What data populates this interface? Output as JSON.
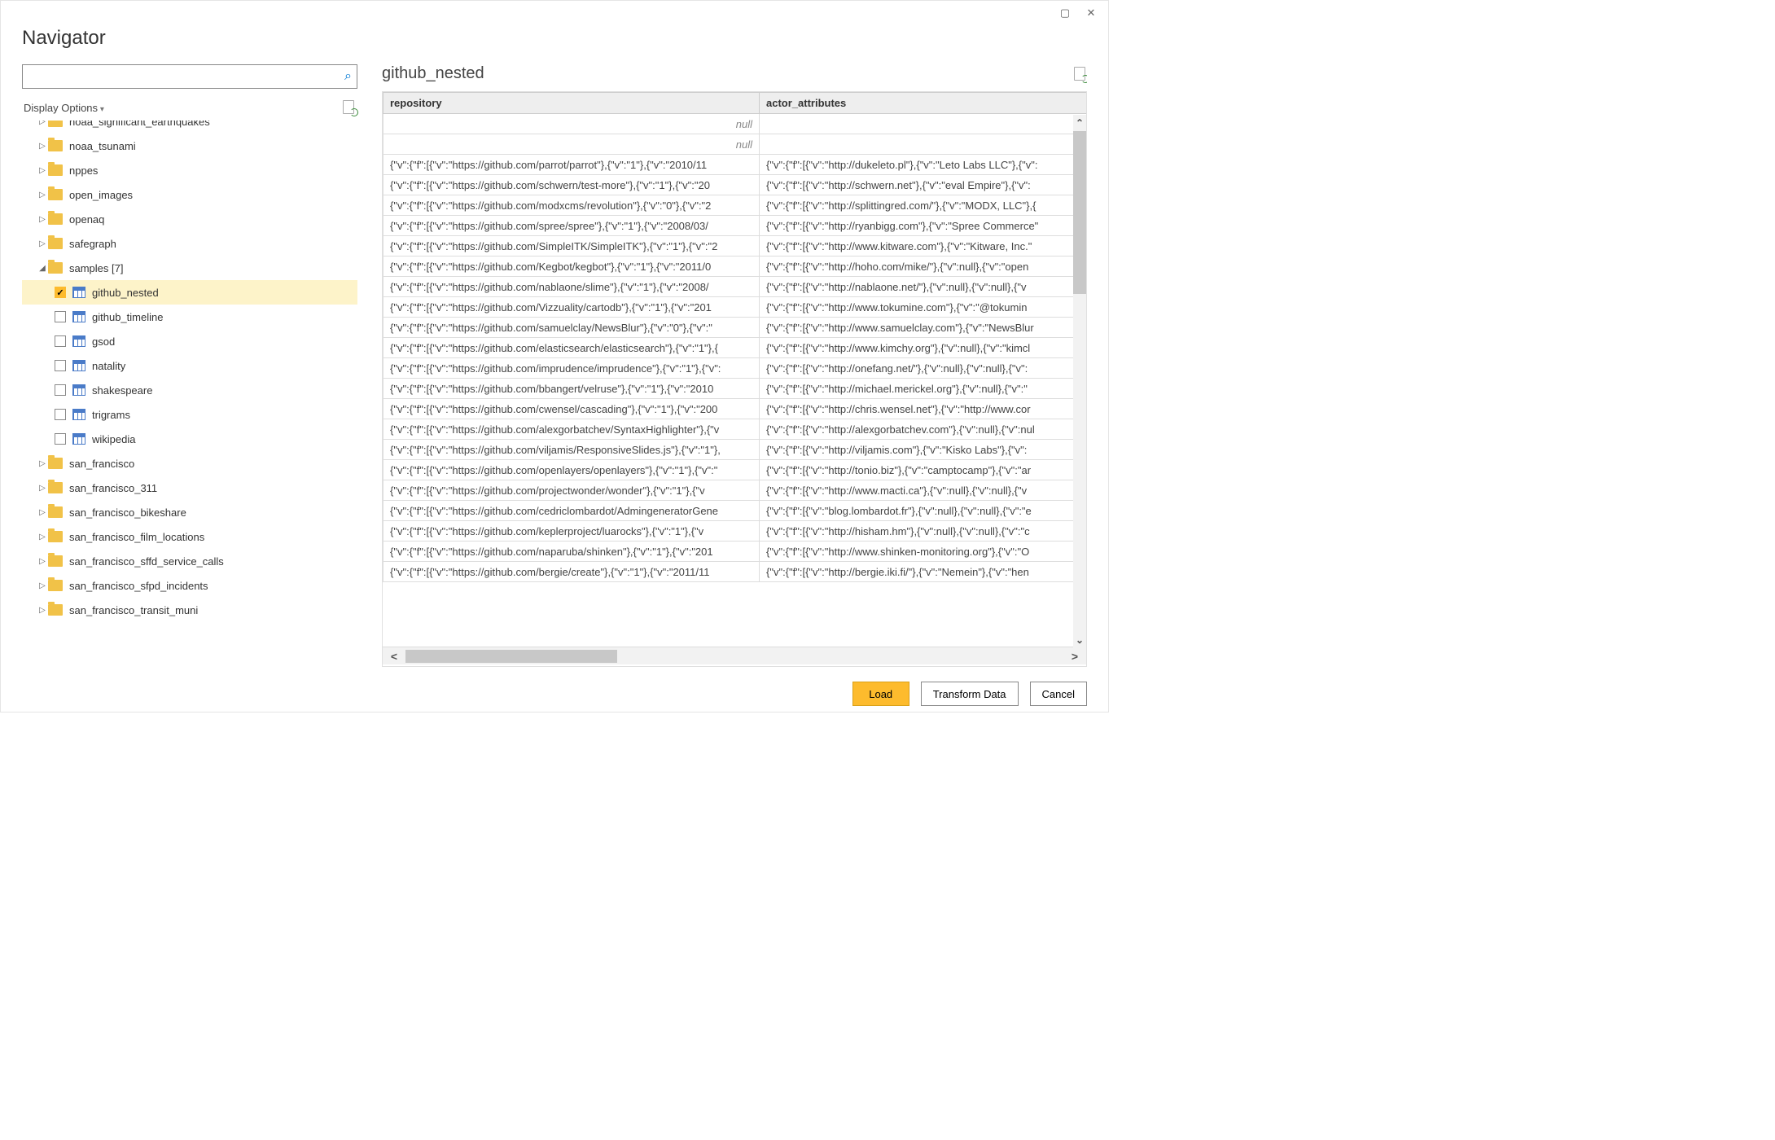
{
  "window": {
    "title": "Navigator"
  },
  "search": {
    "placeholder": ""
  },
  "display_options_label": "Display Options",
  "tree": [
    {
      "label": "noaa_significant_earthquakes",
      "depth": 1,
      "type": "folder",
      "caret": "▷",
      "truncated": true
    },
    {
      "label": "noaa_tsunami",
      "depth": 1,
      "type": "folder",
      "caret": "▷"
    },
    {
      "label": "nppes",
      "depth": 1,
      "type": "folder",
      "caret": "▷"
    },
    {
      "label": "open_images",
      "depth": 1,
      "type": "folder",
      "caret": "▷"
    },
    {
      "label": "openaq",
      "depth": 1,
      "type": "folder",
      "caret": "▷"
    },
    {
      "label": "safegraph",
      "depth": 1,
      "type": "folder",
      "caret": "▷"
    },
    {
      "label": "samples [7]",
      "depth": 1,
      "type": "folder",
      "caret": "◢",
      "expanded": true
    },
    {
      "label": "github_nested",
      "depth": 2,
      "type": "table",
      "checked": true,
      "selected": true
    },
    {
      "label": "github_timeline",
      "depth": 2,
      "type": "table",
      "checked": false
    },
    {
      "label": "gsod",
      "depth": 2,
      "type": "table",
      "checked": false
    },
    {
      "label": "natality",
      "depth": 2,
      "type": "table",
      "checked": false
    },
    {
      "label": "shakespeare",
      "depth": 2,
      "type": "table",
      "checked": false
    },
    {
      "label": "trigrams",
      "depth": 2,
      "type": "table",
      "checked": false
    },
    {
      "label": "wikipedia",
      "depth": 2,
      "type": "table",
      "checked": false
    },
    {
      "label": "san_francisco",
      "depth": 1,
      "type": "folder",
      "caret": "▷"
    },
    {
      "label": "san_francisco_311",
      "depth": 1,
      "type": "folder",
      "caret": "▷"
    },
    {
      "label": "san_francisco_bikeshare",
      "depth": 1,
      "type": "folder",
      "caret": "▷"
    },
    {
      "label": "san_francisco_film_locations",
      "depth": 1,
      "type": "folder",
      "caret": "▷"
    },
    {
      "label": "san_francisco_sffd_service_calls",
      "depth": 1,
      "type": "folder",
      "caret": "▷"
    },
    {
      "label": "san_francisco_sfpd_incidents",
      "depth": 1,
      "type": "folder",
      "caret": "▷"
    },
    {
      "label": "san_francisco_transit_muni",
      "depth": 1,
      "type": "folder",
      "caret": "▷",
      "cutoff": true
    }
  ],
  "preview": {
    "title": "github_nested",
    "columns": [
      "repository",
      "actor_attributes"
    ],
    "rows": [
      {
        "repository": "null",
        "actor": "",
        "null_repo": true
      },
      {
        "repository": "null",
        "actor": "",
        "null_repo": true
      },
      {
        "repository": "{\"v\":{\"f\":[{\"v\":\"https://github.com/parrot/parrot\"},{\"v\":\"1\"},{\"v\":\"2010/11",
        "actor": "{\"v\":{\"f\":[{\"v\":\"http://dukeleto.pl\"},{\"v\":\"Leto Labs LLC\"},{\"v\":"
      },
      {
        "repository": "{\"v\":{\"f\":[{\"v\":\"https://github.com/schwern/test-more\"},{\"v\":\"1\"},{\"v\":\"20",
        "actor": "{\"v\":{\"f\":[{\"v\":\"http://schwern.net\"},{\"v\":\"eval Empire\"},{\"v\":"
      },
      {
        "repository": "{\"v\":{\"f\":[{\"v\":\"https://github.com/modxcms/revolution\"},{\"v\":\"0\"},{\"v\":\"2",
        "actor": "{\"v\":{\"f\":[{\"v\":\"http://splittingred.com/\"},{\"v\":\"MODX, LLC\"},{"
      },
      {
        "repository": "{\"v\":{\"f\":[{\"v\":\"https://github.com/spree/spree\"},{\"v\":\"1\"},{\"v\":\"2008/03/",
        "actor": "{\"v\":{\"f\":[{\"v\":\"http://ryanbigg.com\"},{\"v\":\"Spree Commerce\""
      },
      {
        "repository": "{\"v\":{\"f\":[{\"v\":\"https://github.com/SimpleITK/SimpleITK\"},{\"v\":\"1\"},{\"v\":\"2",
        "actor": "{\"v\":{\"f\":[{\"v\":\"http://www.kitware.com\"},{\"v\":\"Kitware, Inc.\""
      },
      {
        "repository": "{\"v\":{\"f\":[{\"v\":\"https://github.com/Kegbot/kegbot\"},{\"v\":\"1\"},{\"v\":\"2011/0",
        "actor": "{\"v\":{\"f\":[{\"v\":\"http://hoho.com/mike/\"},{\"v\":null},{\"v\":\"open"
      },
      {
        "repository": "{\"v\":{\"f\":[{\"v\":\"https://github.com/nablaone/slime\"},{\"v\":\"1\"},{\"v\":\"2008/",
        "actor": "{\"v\":{\"f\":[{\"v\":\"http://nablaone.net/\"},{\"v\":null},{\"v\":null},{\"v"
      },
      {
        "repository": "{\"v\":{\"f\":[{\"v\":\"https://github.com/Vizzuality/cartodb\"},{\"v\":\"1\"},{\"v\":\"201",
        "actor": "{\"v\":{\"f\":[{\"v\":\"http://www.tokumine.com\"},{\"v\":\"@tokumin"
      },
      {
        "repository": "{\"v\":{\"f\":[{\"v\":\"https://github.com/samuelclay/NewsBlur\"},{\"v\":\"0\"},{\"v\":\"",
        "actor": "{\"v\":{\"f\":[{\"v\":\"http://www.samuelclay.com\"},{\"v\":\"NewsBlur"
      },
      {
        "repository": "{\"v\":{\"f\":[{\"v\":\"https://github.com/elasticsearch/elasticsearch\"},{\"v\":\"1\"},{",
        "actor": "{\"v\":{\"f\":[{\"v\":\"http://www.kimchy.org\"},{\"v\":null},{\"v\":\"kimcl"
      },
      {
        "repository": "{\"v\":{\"f\":[{\"v\":\"https://github.com/imprudence/imprudence\"},{\"v\":\"1\"},{\"v\":",
        "actor": "{\"v\":{\"f\":[{\"v\":\"http://onefang.net/\"},{\"v\":null},{\"v\":null},{\"v\":"
      },
      {
        "repository": "{\"v\":{\"f\":[{\"v\":\"https://github.com/bbangert/velruse\"},{\"v\":\"1\"},{\"v\":\"2010",
        "actor": "{\"v\":{\"f\":[{\"v\":\"http://michael.merickel.org\"},{\"v\":null},{\"v\":\""
      },
      {
        "repository": "{\"v\":{\"f\":[{\"v\":\"https://github.com/cwensel/cascading\"},{\"v\":\"1\"},{\"v\":\"200",
        "actor": "{\"v\":{\"f\":[{\"v\":\"http://chris.wensel.net\"},{\"v\":\"http://www.cor"
      },
      {
        "repository": "{\"v\":{\"f\":[{\"v\":\"https://github.com/alexgorbatchev/SyntaxHighlighter\"},{\"v",
        "actor": "{\"v\":{\"f\":[{\"v\":\"http://alexgorbatchev.com\"},{\"v\":null},{\"v\":nul"
      },
      {
        "repository": "{\"v\":{\"f\":[{\"v\":\"https://github.com/viljamis/ResponsiveSlides.js\"},{\"v\":\"1\"},",
        "actor": "{\"v\":{\"f\":[{\"v\":\"http://viljamis.com\"},{\"v\":\"Kisko Labs\"},{\"v\":"
      },
      {
        "repository": "{\"v\":{\"f\":[{\"v\":\"https://github.com/openlayers/openlayers\"},{\"v\":\"1\"},{\"v\":\"",
        "actor": "{\"v\":{\"f\":[{\"v\":\"http://tonio.biz\"},{\"v\":\"camptocamp\"},{\"v\":\"ar"
      },
      {
        "repository": "{\"v\":{\"f\":[{\"v\":\"https://github.com/projectwonder/wonder\"},{\"v\":\"1\"},{\"v",
        "actor": "{\"v\":{\"f\":[{\"v\":\"http://www.macti.ca\"},{\"v\":null},{\"v\":null},{\"v"
      },
      {
        "repository": "{\"v\":{\"f\":[{\"v\":\"https://github.com/cedriclombardot/AdmingeneratorGene",
        "actor": "{\"v\":{\"f\":[{\"v\":\"blog.lombardot.fr\"},{\"v\":null},{\"v\":null},{\"v\":\"e"
      },
      {
        "repository": "{\"v\":{\"f\":[{\"v\":\"https://github.com/keplerproject/luarocks\"},{\"v\":\"1\"},{\"v",
        "actor": "{\"v\":{\"f\":[{\"v\":\"http://hisham.hm\"},{\"v\":null},{\"v\":null},{\"v\":\"c"
      },
      {
        "repository": "{\"v\":{\"f\":[{\"v\":\"https://github.com/naparuba/shinken\"},{\"v\":\"1\"},{\"v\":\"201",
        "actor": "{\"v\":{\"f\":[{\"v\":\"http://www.shinken-monitoring.org\"},{\"v\":\"O"
      },
      {
        "repository": "{\"v\":{\"f\":[{\"v\":\"https://github.com/bergie/create\"},{\"v\":\"1\"},{\"v\":\"2011/11",
        "actor": "{\"v\":{\"f\":[{\"v\":\"http://bergie.iki.fi/\"},{\"v\":\"Nemein\"},{\"v\":\"hen"
      }
    ]
  },
  "buttons": {
    "load": "Load",
    "transform": "Transform Data",
    "cancel": "Cancel"
  }
}
